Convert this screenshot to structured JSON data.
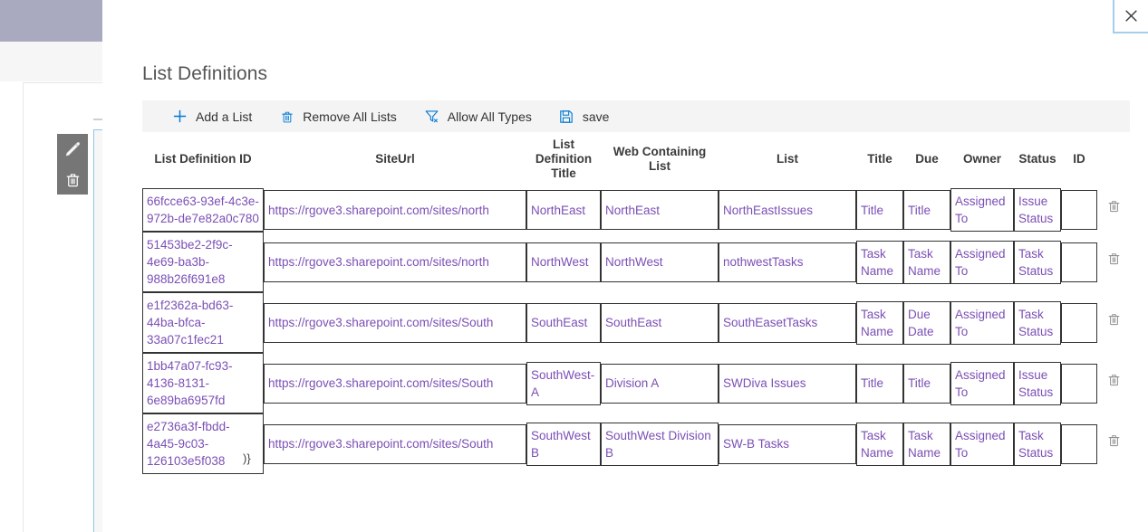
{
  "backdrop": {
    "edit_icon": "pencil-icon",
    "delete_icon": "trash-icon"
  },
  "dialog": {
    "title": "List Definitions",
    "close_label": "✕",
    "trailing_text": ")}"
  },
  "toolbar": {
    "items": [
      {
        "label": "Add a List",
        "icon": "plus-icon"
      },
      {
        "label": "Remove All Lists",
        "icon": "trash-icon"
      },
      {
        "label": "Allow All Types",
        "icon": "filter-clear-icon"
      },
      {
        "label": "save",
        "icon": "save-icon"
      }
    ]
  },
  "table": {
    "columns": [
      "List Definition ID",
      "SiteUrl",
      "List Definition Title",
      "Web Containing List",
      "List",
      "Title",
      "Due",
      "Owner",
      "Status",
      "ID"
    ],
    "row_delete_icon": "trash-icon",
    "rows": [
      {
        "list_definition_id": "66fcce63-93ef-4c3e-972b-de7e82a0c780",
        "site_url": "https://rgove3.sharepoint.com/sites/north",
        "list_definition_title": "NorthEast",
        "web_containing_list": "NorthEast",
        "list": "NorthEastIssues",
        "title": "Title",
        "due": "Title",
        "owner": "Assigned To",
        "status": "Issue Status",
        "id": ""
      },
      {
        "list_definition_id": "51453be2-2f9c-4e69-ba3b-988b26f691e8",
        "site_url": "https://rgove3.sharepoint.com/sites/north",
        "list_definition_title": "NorthWest",
        "web_containing_list": "NorthWest",
        "list": "nothwestTasks",
        "title": "Task Name",
        "due": "Task Name",
        "owner": "Assigned To",
        "status": "Task Status",
        "id": ""
      },
      {
        "list_definition_id": "e1f2362a-bd63-44ba-bfca-33a07c1fec21",
        "site_url": "https://rgove3.sharepoint.com/sites/South",
        "list_definition_title": "SouthEast",
        "web_containing_list": "SouthEast",
        "list": "SouthEasetTasks",
        "title": "Task Name",
        "due": "Due Date",
        "owner": "Assigned To",
        "status": "Task Status",
        "id": ""
      },
      {
        "list_definition_id": "1bb47a07-fc93-4136-8131-6e89ba6957fd",
        "site_url": "https://rgove3.sharepoint.com/sites/South",
        "list_definition_title": "SouthWest-A",
        "web_containing_list": "Division A",
        "list": "SWDiva Issues",
        "title": "Title",
        "due": "Title",
        "owner": "Assigned To",
        "status": "Issue Status",
        "id": ""
      },
      {
        "list_definition_id": "e2736a3f-fbdd-4a45-9c03-126103e5f038",
        "site_url": "https://rgove3.sharepoint.com/sites/South",
        "list_definition_title": "SouthWest B",
        "web_containing_list": "SouthWest Division B",
        "list": "SW-B Tasks",
        "title": "Task Name",
        "due": "Task Name",
        "owner": "Assigned To",
        "status": "Task Status",
        "id": ""
      }
    ]
  },
  "colors": {
    "cell_text": "#7b4fb5",
    "accent": "#0078d4",
    "command_bar_bg": "#f4f4f4",
    "backdrop_topbar": "#a9a9c0"
  }
}
